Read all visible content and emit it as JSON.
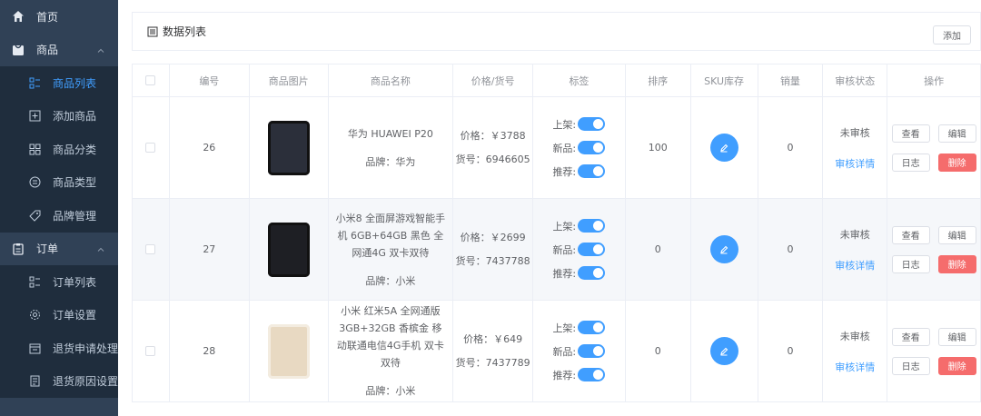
{
  "sidebar": {
    "home": "首页",
    "product": "商品",
    "product_items": [
      {
        "label": "商品列表",
        "icon": "product-list-icon"
      },
      {
        "label": "添加商品",
        "icon": "add-product-icon"
      },
      {
        "label": "商品分类",
        "icon": "category-icon"
      },
      {
        "label": "商品类型",
        "icon": "type-icon"
      },
      {
        "label": "品牌管理",
        "icon": "brand-icon"
      }
    ],
    "order": "订单",
    "order_items": [
      {
        "label": "订单列表",
        "icon": "order-list-icon"
      },
      {
        "label": "订单设置",
        "icon": "order-settings-icon"
      },
      {
        "label": "退货申请处理",
        "icon": "return-request-icon"
      },
      {
        "label": "退货原因设置",
        "icon": "return-reason-icon"
      }
    ],
    "colors": {
      "bg": "#304156",
      "sub_bg": "#1f2d3d",
      "active": "#409eff"
    }
  },
  "panel": {
    "title": "数据列表",
    "add_label": "添加"
  },
  "table": {
    "headers": [
      "编号",
      "商品图片",
      "商品名称",
      "价格/货号",
      "标签",
      "排序",
      "SKU库存",
      "销量",
      "审核状态",
      "操作"
    ],
    "rows": [
      {
        "id": "26",
        "name": "华为 HUAWEI P20",
        "brand": "品牌：华为",
        "price": "价格：￥3788",
        "sku": "货号：6946605",
        "sort": "100",
        "sales": "0",
        "status": "未审核",
        "detail": "审核详情",
        "phone_color": "#2b2f3a"
      },
      {
        "id": "27",
        "name": "小米8 全面屏游戏智能手机 6GB+64GB 黑色 全网通4G 双卡双待",
        "brand": "品牌：小米",
        "price": "价格：￥2699",
        "sku": "货号：7437788",
        "sort": "0",
        "sales": "0",
        "status": "未审核",
        "detail": "审核详情",
        "phone_color": "#1e1f24"
      },
      {
        "id": "28",
        "name": "小米 红米5A 全网通版 3GB+32GB 香槟金 移动联通电信4G手机 双卡双待",
        "brand": "品牌：小米",
        "price": "价格：￥649",
        "sku": "货号：7437789",
        "sort": "0",
        "sales": "0",
        "status": "未审核",
        "detail": "审核详情",
        "phone_color": "#e8d9c2"
      }
    ],
    "tag_labels": {
      "publish": "上架:",
      "new": "新品:",
      "recommend": "推荐:"
    },
    "ops": {
      "view": "查看",
      "edit": "编辑",
      "log": "日志",
      "delete": "删除"
    }
  }
}
